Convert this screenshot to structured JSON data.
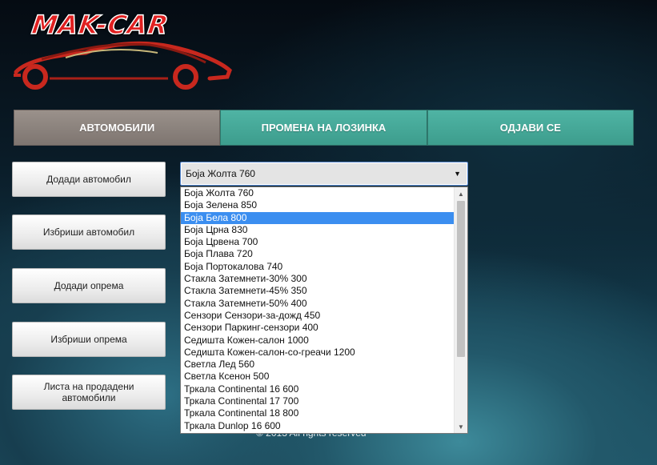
{
  "logo": {
    "text": "MAK-CAR"
  },
  "nav": {
    "items": [
      {
        "label": "АВТОМОБИЛИ"
      },
      {
        "label": "ПРОМЕНА НА ЛОЗИНКА"
      },
      {
        "label": "ОДЈАВИ СЕ"
      }
    ]
  },
  "sidebar": {
    "buttons": [
      {
        "label": "Додади автомобил"
      },
      {
        "label": "Избриши автомобил"
      },
      {
        "label": "Додади опрема"
      },
      {
        "label": "Избриши опрема"
      },
      {
        "label": "Листа на продадени автомобили"
      }
    ]
  },
  "select": {
    "value": "Боја Жолта 760",
    "options": [
      "Боја Жолта 760",
      "Боја Зелена 850",
      "Боја Бела 800",
      "Боја Црна 830",
      "Боја Црвена 700",
      "Боја Плава 720",
      "Боја Портокалова 740",
      "Стакла Затемнети-30% 300",
      "Стакла Затемнети-45% 350",
      "Стакла Затемнети-50% 400",
      "Сензори Сензори-за-дожд 450",
      "Сензори Паркинг-сензори 400",
      "Седишта Кожен-салон 1000",
      "Седишта Кожен-салон-со-греачи 1200",
      "Светла Лед 560",
      "Светла Ксенон 500",
      "Тркала Continental 16 600",
      "Тркала Continental 17 700",
      "Тркала Continental 18 800",
      "Тркала Dunlop 16 600"
    ],
    "highlighted": "Боја Бела 800"
  },
  "footer": {
    "text": "© 2013 All rights reserved"
  },
  "icons": {
    "select_arrow": "chevron-down-icon",
    "scroll_up": "scroll-up-icon",
    "scroll_down": "scroll-down-icon",
    "logo_car": "car-silhouette-icon"
  },
  "colors": {
    "nav_active": "#8a817c",
    "nav_teal": "#45a797",
    "option_highlight": "#3b8ef0",
    "logo_red": "#e02020"
  }
}
